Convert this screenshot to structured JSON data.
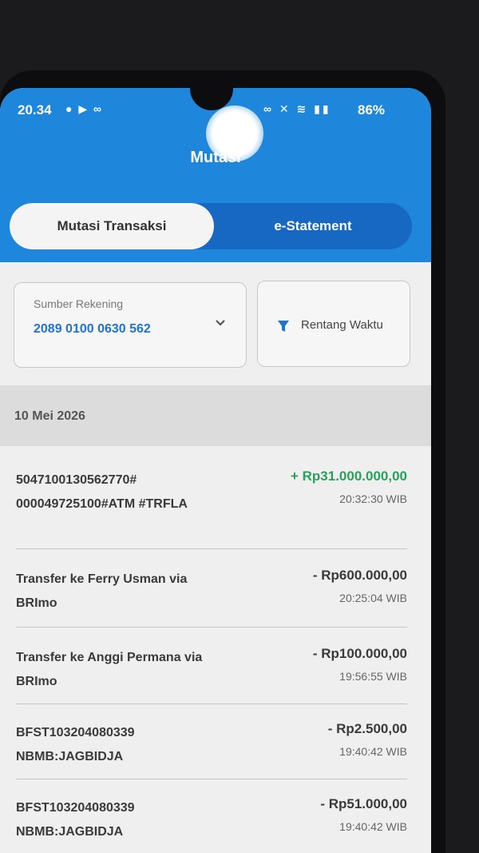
{
  "status": {
    "time": "20.34",
    "battery": "86%"
  },
  "header": {
    "title": "Mutasi"
  },
  "tabs": [
    {
      "label": "Mutasi Transaksi",
      "active": true
    },
    {
      "label": "e-Statement",
      "active": false
    }
  ],
  "filters": {
    "source_label": "Sumber Rekening",
    "source_value": "2089 0100 0630 562",
    "time_label": "Rentang Waktu"
  },
  "date_header": "10 Mei 2026",
  "colors": {
    "brand_blue": "#1e86db",
    "credit_green": "#2aa15a"
  },
  "transactions": [
    {
      "desc": "5047100130562770# 000049725100#ATM #TRFLA",
      "amount": "+ Rp31.000.000,00",
      "time": "20:32:30 WIB",
      "type": "credit"
    },
    {
      "desc": "Transfer ke Ferry Usman via BRImo",
      "amount": "- Rp600.000,00",
      "time": "20:25:04 WIB",
      "type": "debit"
    },
    {
      "desc": "Transfer ke Anggi Permana via BRImo",
      "amount": "- Rp100.000,00",
      "time": "19:56:55 WIB",
      "type": "debit"
    },
    {
      "desc": "BFST103204080339 NBMB:JAGBIDJA",
      "amount": "- Rp2.500,00",
      "time": "19:40:42 WIB",
      "type": "debit"
    },
    {
      "desc": "BFST103204080339 NBMB:JAGBIDJA",
      "amount": "- Rp51.000,00",
      "time": "19:40:42 WIB",
      "type": "debit"
    }
  ]
}
